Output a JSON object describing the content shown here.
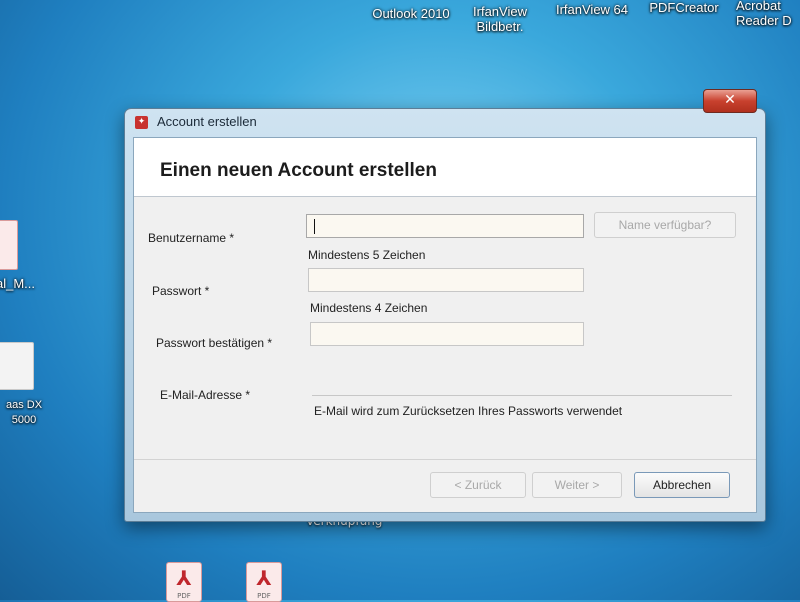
{
  "desktop": {
    "icons_top": [
      {
        "label": "Outlook 2010"
      },
      {
        "label_line1": "IrfanView",
        "label_line2": "Bildbetr."
      },
      {
        "label": "IrfanView 64"
      },
      {
        "label": "PDFCreator"
      },
      {
        "label_line1": "Acrobat",
        "label_line2": "Reader D"
      }
    ],
    "left_icons": [
      {
        "label": "al_M..."
      },
      {
        "label_line1": "aas DX",
        "label_line2": "5000"
      }
    ],
    "under_window_text": "Verknüpfung",
    "pdf_label": "PDF"
  },
  "window": {
    "title": "Account erstellen",
    "close_symbol": "✕",
    "header_title": "Einen neuen Account erstellen",
    "fields": {
      "username": {
        "label": "Benutzername *",
        "value": "",
        "hint": "Mindestens 5 Zeichen"
      },
      "password": {
        "label": "Passwort *",
        "value": "",
        "hint": "Mindestens 4 Zeichen"
      },
      "password_confirm": {
        "label": "Passwort bestätigen *",
        "value": ""
      },
      "email": {
        "label": "E-Mail-Adresse *",
        "value": "",
        "hint": "E-Mail wird zum Zurücksetzen Ihres Passworts verwendet"
      }
    },
    "buttons": {
      "check_name": "Name verfügbar?",
      "back": "< Zurück",
      "next": "Weiter >",
      "cancel": "Abbrechen"
    }
  }
}
